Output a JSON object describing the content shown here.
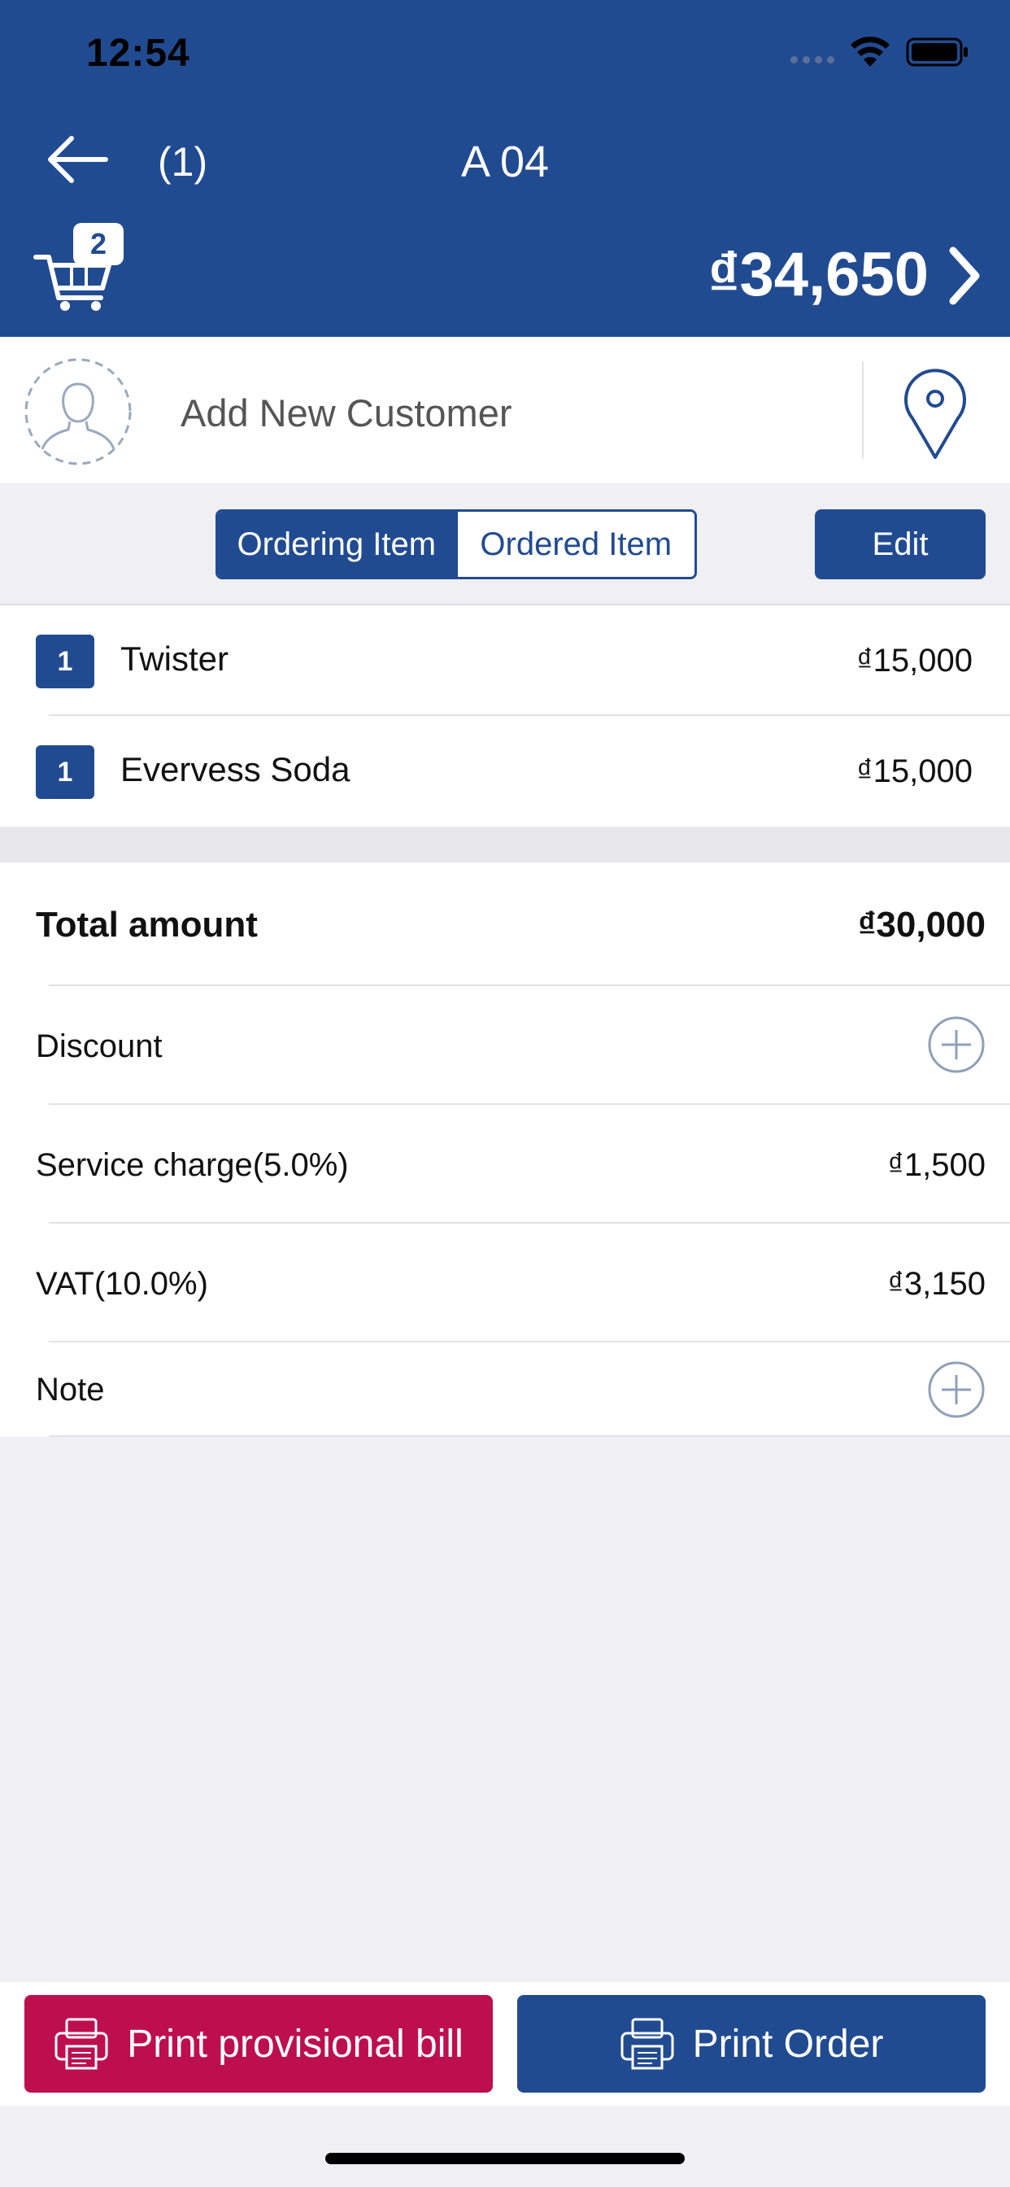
{
  "status_bar": {
    "time": "12:54"
  },
  "header": {
    "order_count": "(1)",
    "table_name": "A 04",
    "cart_badge": "2",
    "grand_total": "₫34,650"
  },
  "customer": {
    "placeholder": "Add New Customer"
  },
  "segment": {
    "ordering": "Ordering Item",
    "ordered": "Ordered Item",
    "edit": "Edit"
  },
  "items": [
    {
      "qty": "1",
      "name": "Twister",
      "price": "₫15,000"
    },
    {
      "qty": "1",
      "name": "Evervess Soda",
      "price": "₫15,000"
    }
  ],
  "totals": {
    "total_label": "Total amount",
    "total_value": "₫30,000",
    "discount_label": "Discount",
    "service_label": "Service charge(5.0%)",
    "service_value": "₫1,500",
    "vat_label": "VAT(10.0%)",
    "vat_value": "₫3,150",
    "note_label": "Note"
  },
  "actions": {
    "print_provisional": "Print provisional bill",
    "print_order": "Print Order"
  },
  "colors": {
    "primary": "#214b91",
    "danger": "#bd0f4e",
    "background": "#efeff4"
  }
}
